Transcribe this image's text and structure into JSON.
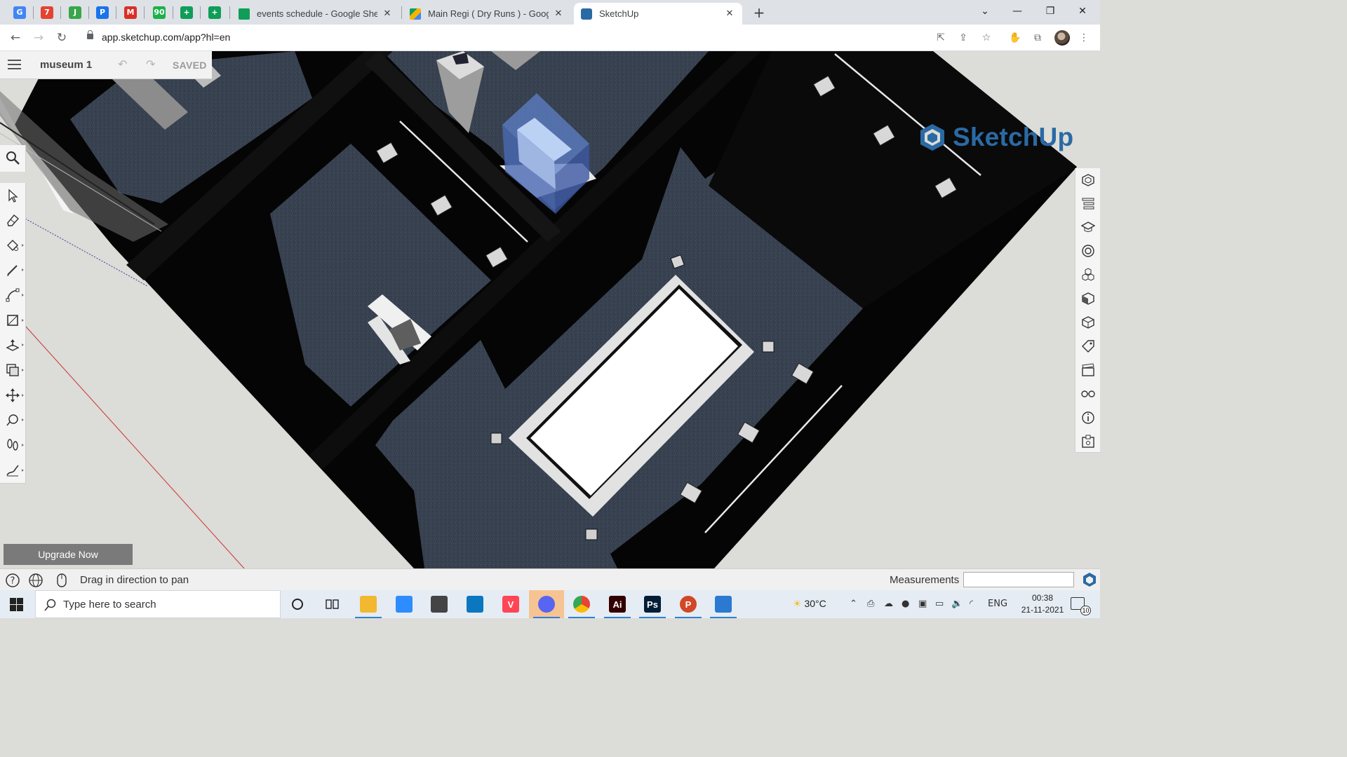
{
  "browser": {
    "pinned_tabs": [
      {
        "icon": "google-icon",
        "glyph": "G",
        "color": "#4285f4"
      },
      {
        "icon": "todoist-icon",
        "glyph": "7",
        "color": "#e44332"
      },
      {
        "icon": "app-icon-green",
        "glyph": "J",
        "color": "#3aa54a"
      },
      {
        "icon": "contacts-icon",
        "glyph": "P",
        "color": "#1a73e8"
      },
      {
        "icon": "gmail-icon",
        "glyph": "M",
        "color": "#d93025"
      },
      {
        "icon": "counter-icon",
        "glyph": "90",
        "color": "#18b24a"
      },
      {
        "icon": "sheets-icon",
        "glyph": "+",
        "color": "#0f9d58"
      },
      {
        "icon": "sheets-icon",
        "glyph": "+",
        "color": "#0f9d58"
      }
    ],
    "tabs": [
      {
        "title": "events schedule - Google Sheets",
        "icon": "sheets-icon",
        "color": "#0f9d58"
      },
      {
        "title": "Main Regi ( Dry Runs ) - Google D",
        "icon": "drive-icon",
        "color": "#f4b400"
      },
      {
        "title": "SketchUp",
        "icon": "sketchup-icon",
        "color": "#2a6aa4"
      }
    ],
    "new_tab": "+",
    "url": "app.sketchup.com/app?hl=en",
    "window_controls": [
      "⌄",
      "—",
      "❐",
      "✕"
    ]
  },
  "sketchup": {
    "model_name": "museum 1",
    "save_status": "SAVED",
    "brand": "SketchUp",
    "left_tools": [
      "select-tool",
      "eraser-tool",
      "paint-bucket-tool",
      "line-tool",
      "arc-tool",
      "rectangle-tool",
      "push-pull-tool",
      "offset-tool",
      "move-tool",
      "tape-measure-tool",
      "walk-tool",
      "freehand-tool"
    ],
    "right_panels": [
      "entity-info-panel",
      "outliner-panel",
      "instructor-panel",
      "materials-panel",
      "components-panel",
      "styles-panel",
      "display-panel",
      "tags-panel",
      "scenes-panel",
      "viewer-panel",
      "info-panel",
      "extensions-panel"
    ],
    "upgrade_label": "Upgrade Now",
    "status_text": "Drag in direction to pan",
    "measurements_label": "Measurements",
    "measurements_value": ""
  },
  "taskbar": {
    "search_placeholder": "Type here to search",
    "weather": "30°C",
    "language": "ENG",
    "time": "00:38",
    "date": "21-11-2021",
    "notification_count": "10",
    "apps": [
      {
        "name": "file-explorer-icon",
        "color": "#f2b830",
        "glyph": "",
        "running": true
      },
      {
        "name": "zoom-icon",
        "color": "#2d8cff",
        "glyph": "",
        "running": false
      },
      {
        "name": "store-icon",
        "color": "#444",
        "glyph": "",
        "running": false
      },
      {
        "name": "dell-icon",
        "color": "#0a77c0",
        "glyph": "",
        "running": false
      },
      {
        "name": "valorant-icon",
        "color": "#ff4655",
        "glyph": "V",
        "running": false
      },
      {
        "name": "discord-icon",
        "color": "#5865f2",
        "glyph": "",
        "running": true
      },
      {
        "name": "chrome-icon",
        "color": "#34a853",
        "glyph": "",
        "running": true
      },
      {
        "name": "illustrator-icon",
        "color": "#330000",
        "glyph": "Ai",
        "running": true
      },
      {
        "name": "photoshop-icon",
        "color": "#001e36",
        "glyph": "Ps",
        "running": true
      },
      {
        "name": "powerpoint-icon",
        "color": "#d24726",
        "glyph": "P",
        "running": true
      },
      {
        "name": "photos-icon",
        "color": "#2b79d0",
        "glyph": "",
        "running": true
      }
    ]
  }
}
